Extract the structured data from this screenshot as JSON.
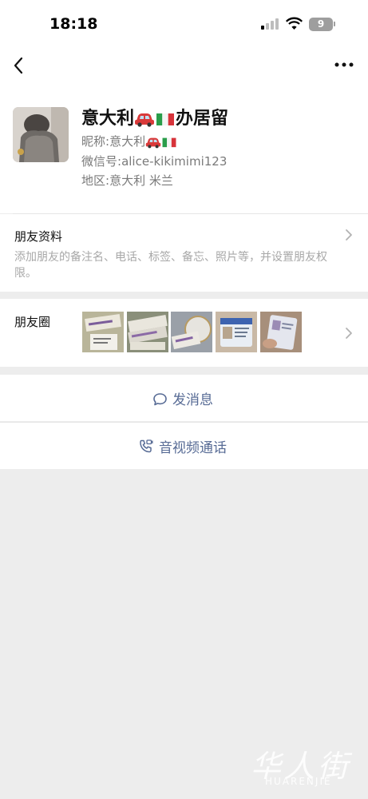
{
  "status_bar": {
    "time": "18:18",
    "battery": "9"
  },
  "nav": {
    "back_icon": "chevron-left-icon",
    "more_icon": "ellipsis-icon"
  },
  "profile": {
    "name": "意大利",
    "name_suffix": "办居留",
    "nickname_label": "昵称:",
    "nickname": "意大利",
    "wechat_id_label": "微信号:",
    "wechat_id": "alice-kikimimi123",
    "region_label": "地区:",
    "region": "意大利 米兰",
    "emoji_car": "red-car-emoji",
    "emoji_flag": "italy-flag-emoji"
  },
  "friend_info": {
    "title": "朋友资料",
    "description": "添加朋友的备注名、电话、标签、备忘、照片等，并设置朋友权限。"
  },
  "moments": {
    "title": "朋友圈",
    "thumbnails": [
      "photo-thumbnail",
      "photo-thumbnail",
      "photo-thumbnail",
      "photo-thumbnail",
      "photo-thumbnail"
    ]
  },
  "actions": {
    "send_message": "发消息",
    "video_call": "音视频通话"
  },
  "watermark": {
    "chinese": "华人街",
    "english": "HUARENJIE"
  },
  "colors": {
    "link_blue": "#576b95",
    "background": "#ededed",
    "muted_text": "#7a7a7a"
  }
}
